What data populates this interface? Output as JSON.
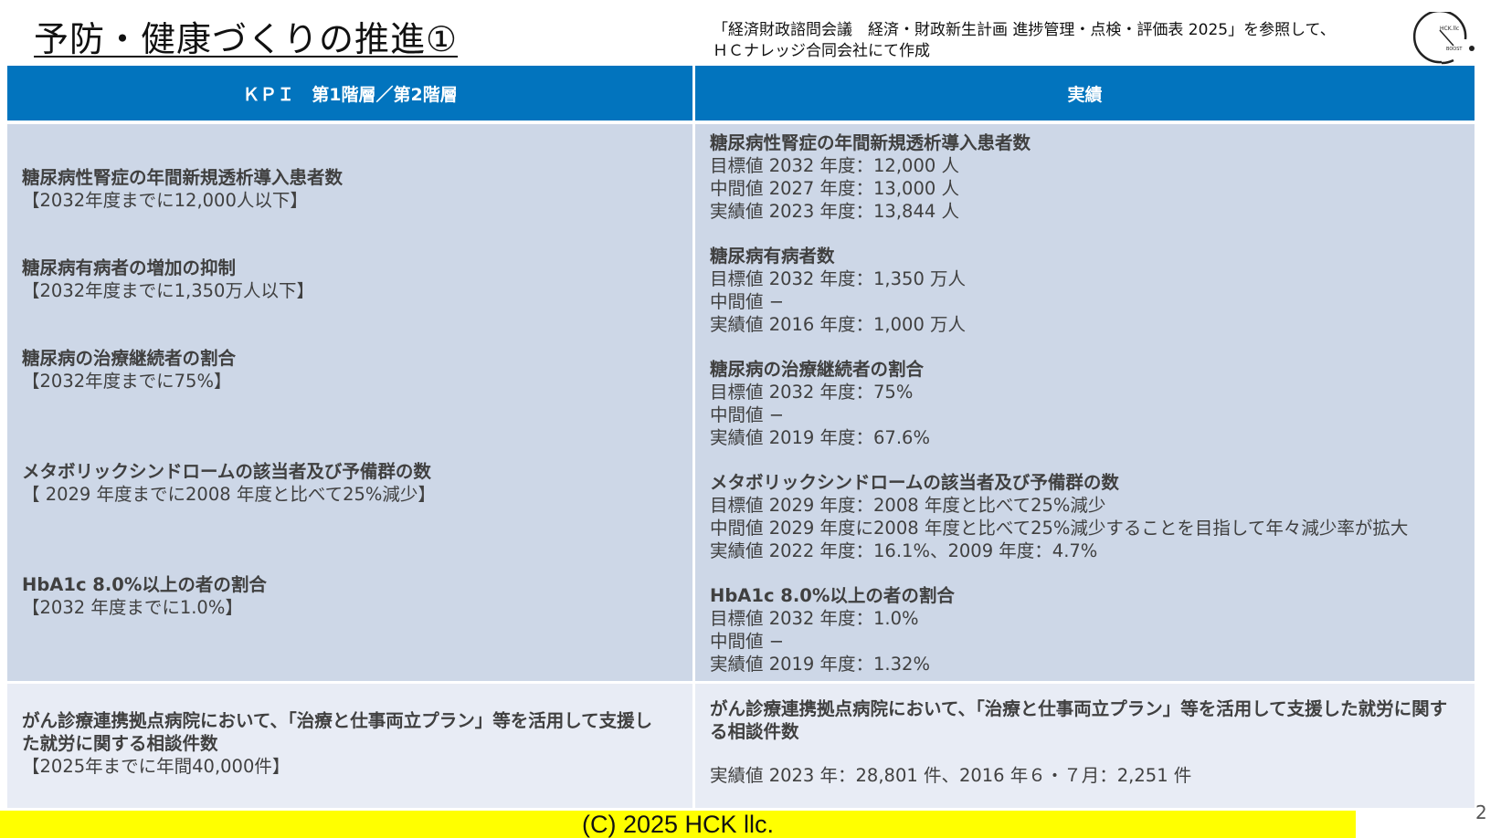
{
  "title": "予防・健康づくりの推進①",
  "source_line1": "「経済財政諮問会議　経済・財政新生計画 進捗管理・点検・評価表 2025」を参照して、",
  "source_line2": "ＨＣナレッジ合同会社にて作成",
  "header": {
    "kpi": "ＫＰＩ　第1階層／第2階層",
    "result": "実績"
  },
  "rows": [
    {
      "kpi_title": "糖尿病性腎症の年間新規透析導入患者数",
      "kpi_target": "【2032年度までに12,000人以下】",
      "res_title": "糖尿病性腎症の年間新規透析導入患者数",
      "res_lines": [
        "目標値 2032 年度：12,000 人",
        "中間値 2027 年度：13,000 人",
        "実績値 2023 年度：13,844 人"
      ]
    },
    {
      "kpi_title": "糖尿病有病者の増加の抑制",
      "kpi_target": "【2032年度までに1,350万人以下】",
      "res_title": "糖尿病有病者数",
      "res_lines": [
        "目標値 2032 年度：1,350 万人",
        "中間値 −",
        "実績値 2016 年度：1,000 万人"
      ]
    },
    {
      "kpi_title": "糖尿病の治療継続者の割合",
      "kpi_target": "【2032年度までに75%】",
      "res_title": "糖尿病の治療継続者の割合",
      "res_lines": [
        "目標値 2032 年度：75%",
        "中間値 −",
        "実績値 2019 年度：67.6%"
      ]
    },
    {
      "kpi_title": "メタボリックシンドロームの該当者及び予備群の数",
      "kpi_target": "【 2029 年度までに2008 年度と比べて25%減少】",
      "res_title": "メタボリックシンドロームの該当者及び予備群の数",
      "res_lines": [
        "目標値 2029 年度：2008 年度と比べて25%減少",
        "中間値 2029 年度に2008 年度と比べて25%減少することを目指して年々減少率が拡大",
        "実績値 2022 年度：16.1%、2009 年度：4.7%"
      ]
    },
    {
      "kpi_title": "HbA1c 8.0%以上の者の割合",
      "kpi_target": "【2032 年度までに1.0%】",
      "res_title": "HbA1c 8.0%以上の者の割合",
      "res_lines": [
        "目標値 2032 年度：1.0%",
        "中間値 −",
        "実績値 2019 年度：1.32%"
      ]
    }
  ],
  "last_row": {
    "kpi_title": "がん診療連携拠点病院において、「治療と仕事両立プラン」等を活用して支援した就労に関する相談件数",
    "kpi_target": "【2025年までに年間40,000件】",
    "res_title": "がん診療連携拠点病院において、「治療と仕事両立プラン」等を活用して支援した就労に関する相談件数",
    "res_value": "実績値 2023 年：28,801 件、2016 年６・７月：2,251 件"
  },
  "footer": "(C) 2025 HCK llc.",
  "page_number": "2",
  "logo": {
    "line1": "HCK.llc",
    "line2": "BOOST"
  }
}
